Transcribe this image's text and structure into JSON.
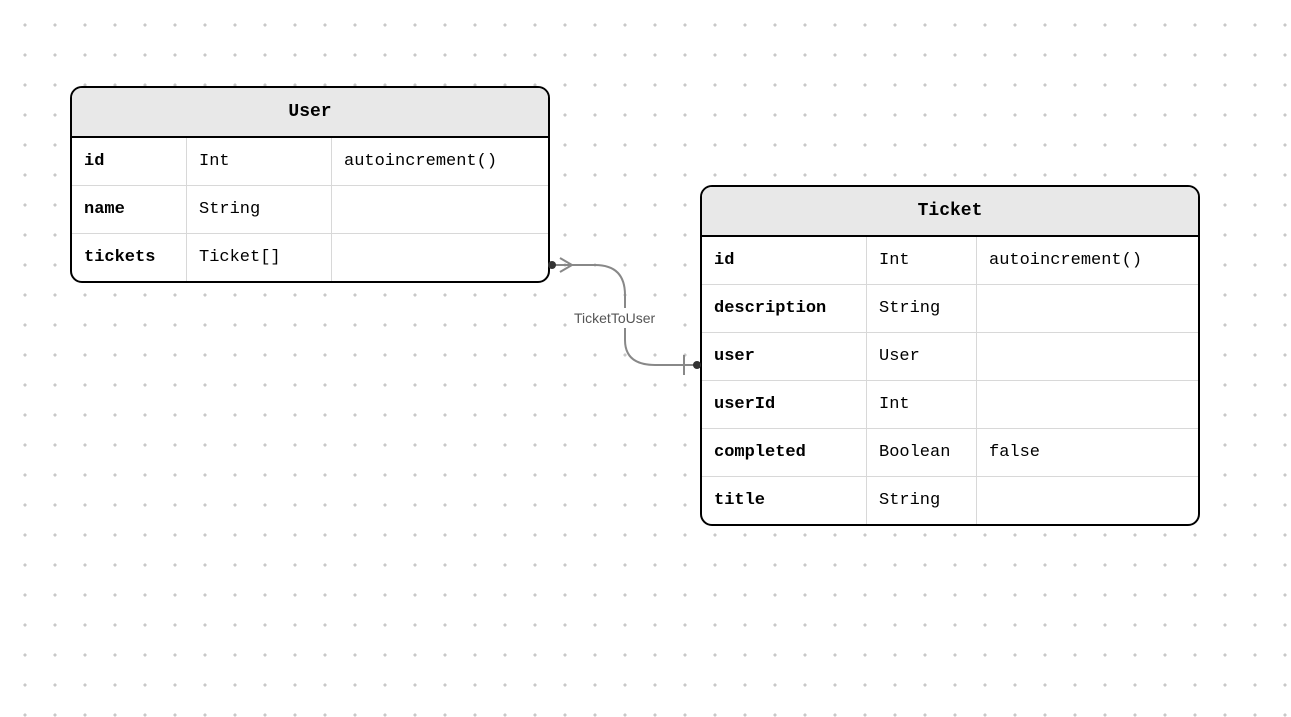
{
  "entities": {
    "user": {
      "title": "User",
      "fields": [
        {
          "name": "id",
          "type": "Int",
          "attr": "autoincrement()"
        },
        {
          "name": "name",
          "type": "String",
          "attr": ""
        },
        {
          "name": "tickets",
          "type": "Ticket[]",
          "attr": ""
        }
      ]
    },
    "ticket": {
      "title": "Ticket",
      "fields": [
        {
          "name": "id",
          "type": "Int",
          "attr": "autoincrement()"
        },
        {
          "name": "description",
          "type": "String",
          "attr": ""
        },
        {
          "name": "user",
          "type": "User",
          "attr": ""
        },
        {
          "name": "userId",
          "type": "Int",
          "attr": ""
        },
        {
          "name": "completed",
          "type": "Boolean",
          "attr": "false"
        },
        {
          "name": "title",
          "type": "String",
          "attr": ""
        }
      ]
    }
  },
  "relation": {
    "label": "TicketToUser"
  }
}
